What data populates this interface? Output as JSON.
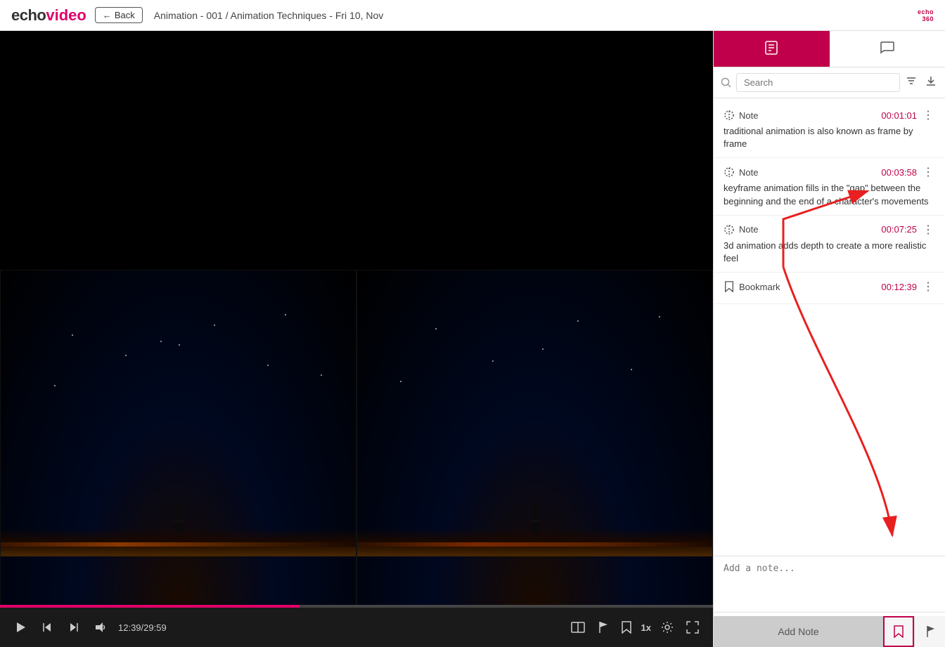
{
  "header": {
    "logo_echo": "echo",
    "logo_video": "video",
    "back_label": "Back",
    "breadcrumb": "Animation - 001 / Animation Techniques - Fri 10, Nov",
    "echo360_line1": "echo",
    "echo360_line2": "360"
  },
  "sidebar": {
    "tab_notes_label": "notes-tab",
    "tab_chat_label": "chat-tab",
    "search_placeholder": "Search",
    "filter_label": "filter",
    "download_label": "download",
    "notes": [
      {
        "type": "Note",
        "timestamp": "00:01:01",
        "content": "traditional animation is also known as frame by frame"
      },
      {
        "type": "Note",
        "timestamp": "00:03:58",
        "content": "keyframe animation fills in the \"gap\" between the beginning and the end of a character's movements"
      },
      {
        "type": "Note",
        "timestamp": "00:07:25",
        "content": "3d animation adds depth to create a more realistic feel"
      },
      {
        "type": "Bookmark",
        "timestamp": "00:12:39",
        "content": ""
      }
    ],
    "add_note_placeholder": "Add a note...",
    "add_note_btn_label": "Add Note"
  },
  "controls": {
    "time_current": "12:39",
    "time_total": "29:59",
    "time_display": "12:39/29:59",
    "speed": "1x"
  }
}
